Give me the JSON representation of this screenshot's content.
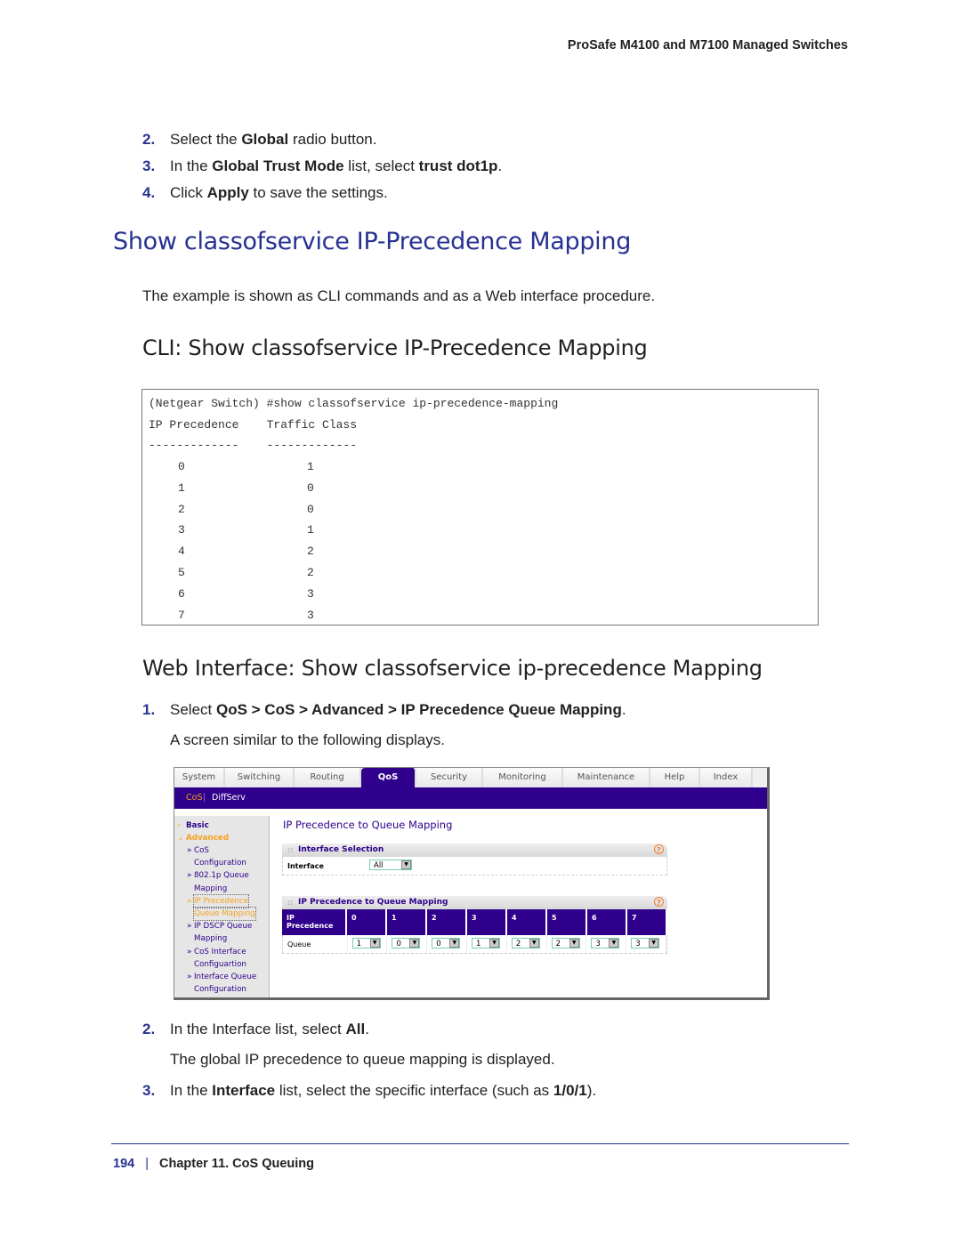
{
  "running_head": "ProSafe M4100 and M7100 Managed Switches",
  "steps_top": [
    {
      "num": "2.",
      "parts": [
        {
          "t": "Select the "
        },
        {
          "b": "Global"
        },
        {
          "t": " radio button."
        }
      ]
    },
    {
      "num": "3.",
      "parts": [
        {
          "t": "In the "
        },
        {
          "b": "Global Trust Mode"
        },
        {
          "t": " list, select "
        },
        {
          "b": "trust dot1p"
        },
        {
          "t": "."
        }
      ]
    },
    {
      "num": "4.",
      "parts": [
        {
          "t": "Click "
        },
        {
          "b": "Apply"
        },
        {
          "t": " to save the settings."
        }
      ]
    }
  ],
  "section_title": "Show classofservice IP-Precedence Mapping",
  "intro": "The example is shown as CLI commands and as a Web interface procedure.",
  "cli_heading": "CLI: Show classofservice IP-Precedence Mapping",
  "cli": {
    "command": "(Netgear Switch) #show classofservice ip-precedence-mapping",
    "header": "IP Precedence    Traffic Class",
    "rule": "-------------    -------------",
    "rows": [
      {
        "prec": "0",
        "tc": "1"
      },
      {
        "prec": "1",
        "tc": "0"
      },
      {
        "prec": "2",
        "tc": "0"
      },
      {
        "prec": "3",
        "tc": "1"
      },
      {
        "prec": "4",
        "tc": "2"
      },
      {
        "prec": "5",
        "tc": "2"
      },
      {
        "prec": "6",
        "tc": "3"
      },
      {
        "prec": "7",
        "tc": "3"
      }
    ]
  },
  "web_heading": "Web Interface: Show classofservice ip-precedence Mapping",
  "web_step1": {
    "num": "1.",
    "parts": [
      {
        "t": "Select "
      },
      {
        "b": "QoS > CoS > Advanced > IP Precedence Queue Mapping"
      },
      {
        "t": "."
      }
    ]
  },
  "web_step1_note": "A screen similar to the following displays.",
  "ui": {
    "tabs": [
      "System",
      "Switching",
      "Routing",
      "QoS",
      "Security",
      "Monitoring",
      "Maintenance",
      "Help",
      "Index"
    ],
    "active_tab": "QoS",
    "subnav": {
      "cos": "CoS",
      "sep": "|",
      "diffserv": "DiffServ"
    },
    "sidebar": {
      "basic": "Basic",
      "advanced": "Advanced",
      "items": [
        [
          "CoS",
          "Configuration"
        ],
        [
          "802.1p Queue",
          "Mapping"
        ],
        [
          "IP Precedence",
          "Queue Mapping"
        ],
        [
          "IP DSCP Queue",
          "Mapping"
        ],
        [
          "CoS Interface",
          "Configuartion"
        ],
        [
          "Interface Queue",
          "Configuration"
        ]
      ],
      "active_index": 2
    },
    "page_title": "IP Precedence to Queue Mapping",
    "interface_panel": {
      "title": "Interface Selection",
      "label": "Interface",
      "value": "All"
    },
    "mapping_panel": {
      "title": "IP Precedence to Queue Mapping",
      "row_header": "IP Precedence",
      "row_label": "Queue",
      "precedences": [
        "0",
        "1",
        "2",
        "3",
        "4",
        "5",
        "6",
        "7"
      ],
      "queues": [
        "1",
        "0",
        "0",
        "1",
        "2",
        "2",
        "3",
        "3"
      ]
    },
    "help_icon": "?",
    "dropdown_icon": "▼"
  },
  "steps_bottom": [
    {
      "num": "2.",
      "parts": [
        {
          "t": "In the Interface list, select "
        },
        {
          "b": "All"
        },
        {
          "t": "."
        }
      ]
    },
    {
      "num": "",
      "parts": [
        {
          "t": "The global IP precedence to queue mapping is displayed."
        }
      ]
    },
    {
      "num": "3.",
      "parts": [
        {
          "t": "In the "
        },
        {
          "b": "Interface"
        },
        {
          "t": " list, select the specific interface (such as "
        },
        {
          "b": "1/0/1"
        },
        {
          "t": ")."
        }
      ]
    }
  ],
  "footer": {
    "page": "194",
    "separator": "|",
    "chapter": "Chapter 11.  CoS Queuing"
  }
}
